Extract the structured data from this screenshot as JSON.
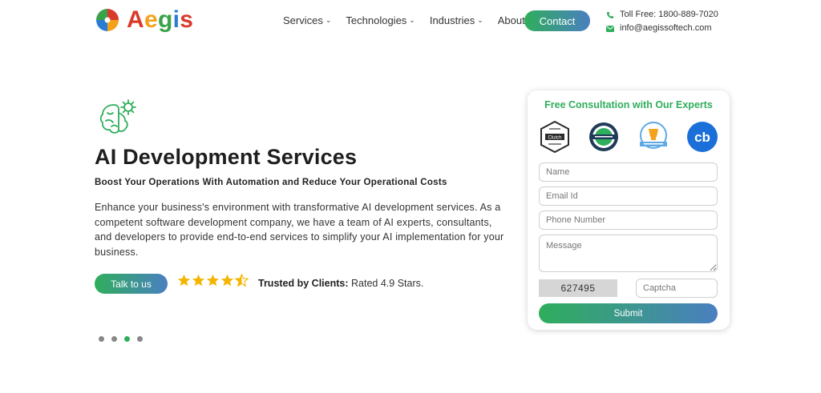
{
  "brand": {
    "name_parts": [
      "A",
      "e",
      "g",
      "i",
      "s"
    ],
    "colors": {
      "primary_green": "#2fae5c",
      "primary_blue": "#4a7fc0",
      "logo_red": "#d93a2c",
      "logo_orange": "#f4a21c",
      "logo_blue": "#2a7bd4"
    }
  },
  "nav": {
    "items": [
      {
        "label": "Services",
        "has_dropdown": true,
        "chevron": "⌄"
      },
      {
        "label": "Technologies",
        "has_dropdown": true,
        "chevron": "⌄"
      },
      {
        "label": "Industries",
        "has_dropdown": true,
        "chevron": "⌄"
      },
      {
        "label": "About",
        "has_dropdown": false,
        "chevron": ""
      }
    ],
    "contact_label": "Contact"
  },
  "contact_info": {
    "toll_free": "Toll Free: 1800-889-7020",
    "email": "info@aegissoftech.com",
    "phone_icon": "phone-icon",
    "mail_icon": "mail-icon"
  },
  "hero": {
    "icon": "ai-brain-gear-icon",
    "title": "AI Development Services",
    "subtitle": "Boost Your Operations With Automation and Reduce Your Operational Costs",
    "description": "Enhance your business's environment with transformative AI development services. As a competent software development company, we have a team of AI experts, consultants, and developers to provide end-to-end services to simplify your AI implementation for your business.",
    "cta_label": "Talk to us",
    "rating": 4.5,
    "trusted_label": "Trusted by Clients:",
    "trusted_value": "Rated 4.9 Stars.",
    "slides": {
      "count": 4,
      "active_index": 2
    }
  },
  "form": {
    "title": "Free Consultation with Our Experts",
    "badges": [
      "clutch-badge-icon",
      "award-badge-icon",
      "top-firm-badge-icon",
      "crunchbase-badge-icon"
    ],
    "badge_texts": {
      "clutch": "Clutch",
      "crunchbase": "cb"
    },
    "name_placeholder": "Name",
    "email_placeholder": "Email Id",
    "phone_placeholder": "Phone Number",
    "message_placeholder": "Message",
    "captcha_code": "627495",
    "captcha_placeholder": "Captcha",
    "submit_label": "Submit"
  }
}
